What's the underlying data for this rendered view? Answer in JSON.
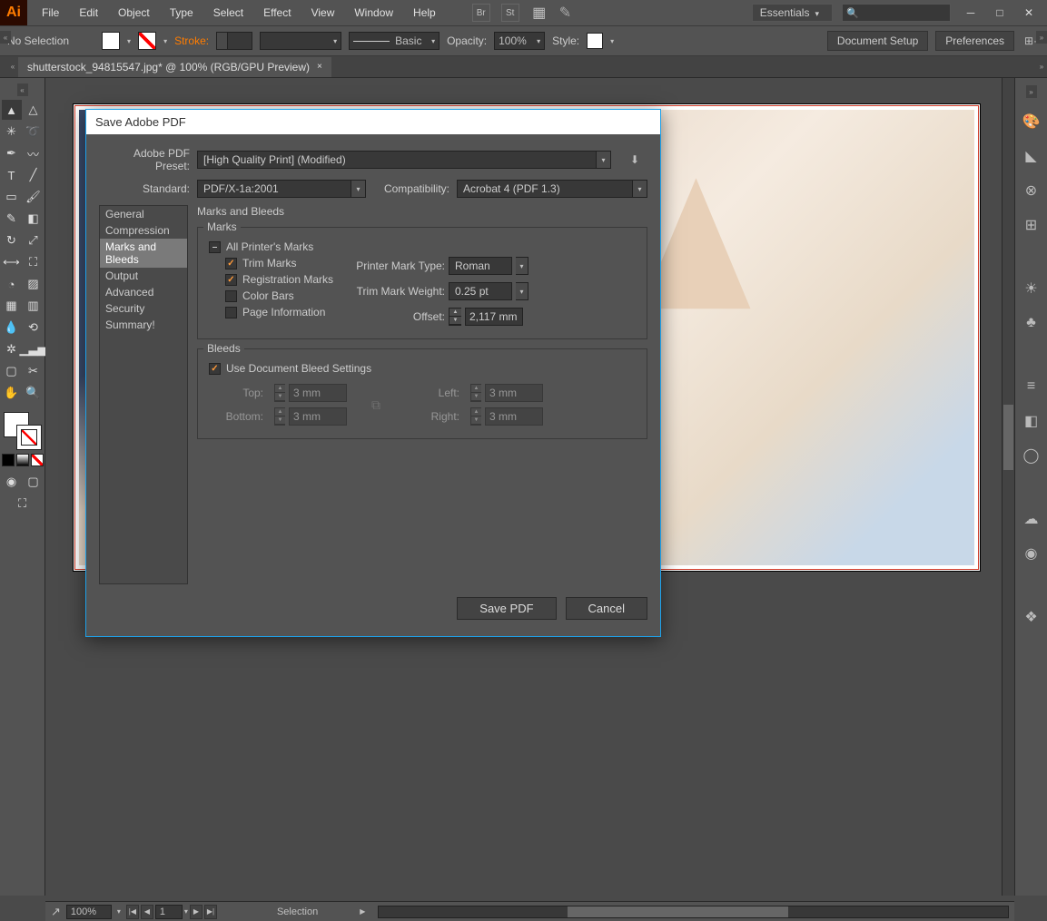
{
  "menu": [
    "File",
    "Edit",
    "Object",
    "Type",
    "Select",
    "Effect",
    "View",
    "Window",
    "Help"
  ],
  "workspace_label": "Essentials",
  "controlbar": {
    "no_selection": "No Selection",
    "stroke_label": "Stroke:",
    "brush_preset": "Basic",
    "opacity_label": "Opacity:",
    "opacity_value": "100%",
    "style_label": "Style:",
    "doc_setup": "Document Setup",
    "preferences": "Preferences"
  },
  "doc_tab": "shutterstock_94815547.jpg* @ 100% (RGB/GPU Preview)",
  "statusbar": {
    "zoom": "100%",
    "page": "1",
    "tool": "Selection"
  },
  "dialog": {
    "title": "Save Adobe PDF",
    "preset_label": "Adobe PDF Preset:",
    "preset_value": "[High Quality Print] (Modified)",
    "standard_label": "Standard:",
    "standard_value": "PDF/X-1a:2001",
    "compat_label": "Compatibility:",
    "compat_value": "Acrobat 4 (PDF 1.3)",
    "sidebar": [
      "General",
      "Compression",
      "Marks and Bleeds",
      "Output",
      "Advanced",
      "Security",
      "Summary!"
    ],
    "sidebar_active": 2,
    "section_title": "Marks and Bleeds",
    "marks": {
      "legend": "Marks",
      "all": "All Printer's Marks",
      "trim": "Trim Marks",
      "reg": "Registration Marks",
      "color": "Color Bars",
      "page": "Page Information",
      "mark_type_label": "Printer Mark Type:",
      "mark_type_value": "Roman",
      "weight_label": "Trim Mark Weight:",
      "weight_value": "0.25 pt",
      "offset_label": "Offset:",
      "offset_value": "2,117 mm"
    },
    "bleeds": {
      "legend": "Bleeds",
      "use_doc": "Use Document Bleed Settings",
      "top_l": "Top:",
      "top_v": "3 mm",
      "bottom_l": "Bottom:",
      "bottom_v": "3 mm",
      "left_l": "Left:",
      "left_v": "3 mm",
      "right_l": "Right:",
      "right_v": "3 mm"
    },
    "save_btn": "Save PDF",
    "cancel_btn": "Cancel"
  }
}
